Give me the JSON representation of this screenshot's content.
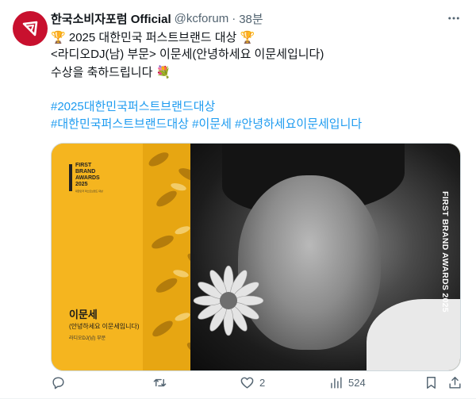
{
  "tweet": {
    "display_name": "한국소비자포럼 Official",
    "handle": "@kcforum",
    "separator": "·",
    "time": "38분",
    "lines": {
      "l1_emoji_left": "🏆",
      "l1_text": " 2025 대한민국 퍼스트브랜드 대상 ",
      "l1_emoji_right": "🏆",
      "l2": "<라디오DJ(남) 부문> 이문세(안녕하세요 이문세입니다)",
      "l3_text": "수상을 축하드립니다 ",
      "l3_emoji": "💐"
    },
    "hashtags": {
      "h1": "#2025대한민국퍼스트브랜드대상",
      "h2": "#대한민국퍼스트브랜드대상",
      "h3": "#이문세",
      "h4": "#안녕하세요이문세입니다"
    }
  },
  "media": {
    "logo_text": "FIRST\nBRAND\nAWARDS\n2025",
    "logo_sub": "대한민국 퍼스트브랜드 대상",
    "name": "이문세",
    "show": "(안녕하세요 이문세입니다)",
    "category": "라디오DJ(남) 부문",
    "vertical_text": "FIRST BRAND AWARDS 2025"
  },
  "actions": {
    "reply_count": "",
    "retweet_count": "",
    "like_count": "2",
    "views_count": "524"
  },
  "icons": {
    "avatar": "kcforum-logo-icon",
    "more": "more-dots-icon",
    "reply": "reply-icon",
    "retweet": "retweet-icon",
    "like": "heart-icon",
    "views": "views-icon",
    "bookmark": "bookmark-icon",
    "share": "share-icon"
  },
  "colors": {
    "link": "#1d9bf0",
    "secondary": "#536471",
    "avatar_bg": "#c8102e",
    "card_gold": "#f5b51f"
  }
}
